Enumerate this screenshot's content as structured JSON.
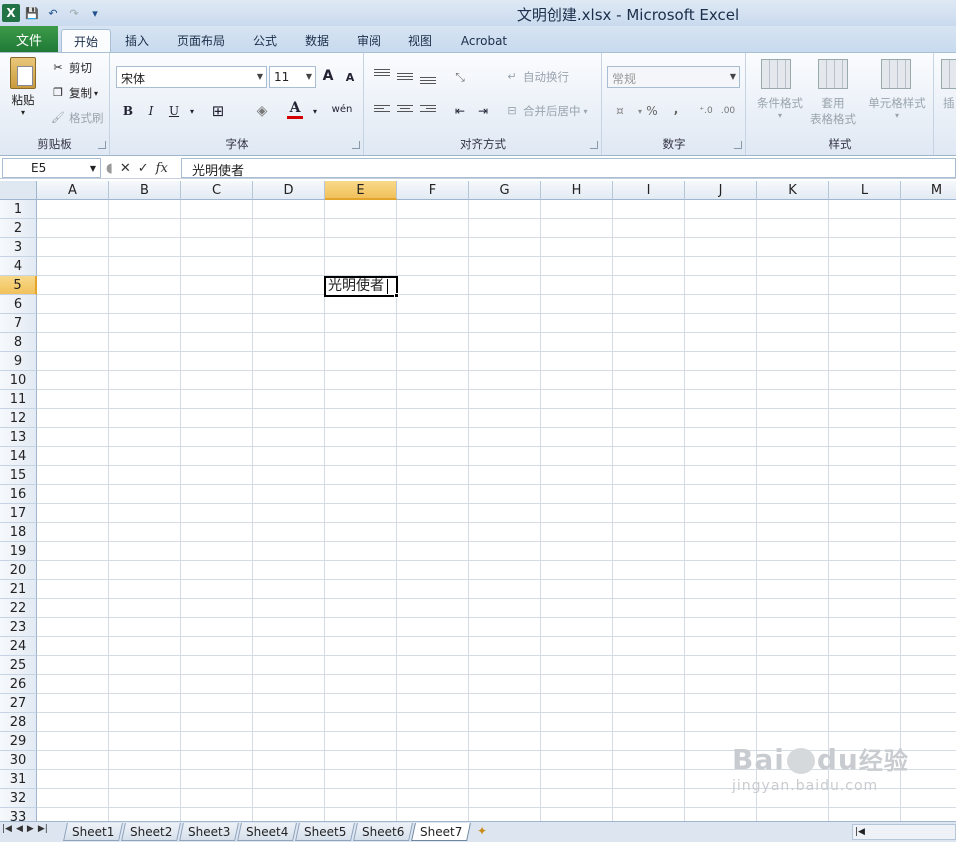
{
  "window": {
    "title": "文明创建.xlsx - Microsoft Excel"
  },
  "qat": {
    "save": "💾",
    "undo": "↶",
    "redo": "↷",
    "more": "▾"
  },
  "ribbon_tabs": [
    "文件",
    "开始",
    "插入",
    "页面布局",
    "公式",
    "数据",
    "审阅",
    "视图",
    "Acrobat"
  ],
  "clipboard": {
    "paste": "粘贴",
    "cut": "剪切",
    "copy": "复制",
    "format_painter": "格式刷",
    "group": "剪贴板"
  },
  "font": {
    "name": "宋体",
    "size": "11",
    "grow": "A",
    "shrink": "A",
    "bold": "B",
    "italic": "I",
    "underline": "U",
    "phonetic": "wén",
    "group": "字体",
    "font_color": "#d40000"
  },
  "alignment": {
    "wrap": "自动换行",
    "merge": "合并后居中",
    "group": "对齐方式"
  },
  "number": {
    "format": "常规",
    "percent": "%",
    "comma": ",",
    "group": "数字"
  },
  "styles": {
    "conditional": "条件格式",
    "table_a": "套用",
    "table_b": "表格格式",
    "cell_styles": "单元格样式",
    "group": "样式"
  },
  "cells": {
    "insert": "插"
  },
  "formula_bar": {
    "name_box": "E5",
    "cancel": "✕",
    "enter": "✓",
    "fx": "fx",
    "content": "光明使者"
  },
  "columns": [
    "A",
    "B",
    "C",
    "D",
    "E",
    "F",
    "G",
    "H",
    "I",
    "J",
    "K",
    "L",
    "M"
  ],
  "rows": [
    "1",
    "2",
    "3",
    "4",
    "5",
    "6",
    "7",
    "8",
    "9",
    "10",
    "11",
    "12",
    "13",
    "14",
    "15",
    "16",
    "17",
    "18",
    "19",
    "20",
    "21",
    "22",
    "23",
    "24",
    "25",
    "26",
    "27",
    "28",
    "29",
    "30",
    "31",
    "32",
    "33"
  ],
  "active_cell": {
    "ref": "E5",
    "value": "光明使者",
    "column": "E",
    "row": "5"
  },
  "watermark": {
    "text": "Bai",
    "text2": "du",
    "text3": "经验",
    "sub": "jingyan.baidu.com"
  },
  "sheets": [
    "Sheet1",
    "Sheet2",
    "Sheet3",
    "Sheet4",
    "Sheet5",
    "Sheet6",
    "Sheet7"
  ],
  "active_sheet": "Sheet7"
}
